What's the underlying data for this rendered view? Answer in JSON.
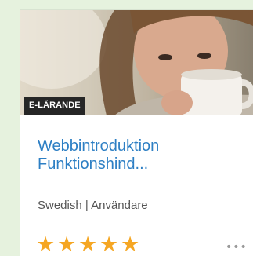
{
  "card": {
    "badge": "E-LÄRANDE",
    "title_line1": "Webbintroduktion",
    "title_line2": "Funktionshind...",
    "meta": "Swedish | Användare",
    "rating": {
      "value": 5,
      "max": 5,
      "icon": "star-icon",
      "color": "#f5a623"
    },
    "more_icon": "more-options-icon",
    "more_glyph": "•••"
  },
  "colors": {
    "background": "#e6f2de",
    "title": "#2d7fc4",
    "badge_bg": "#262626"
  }
}
